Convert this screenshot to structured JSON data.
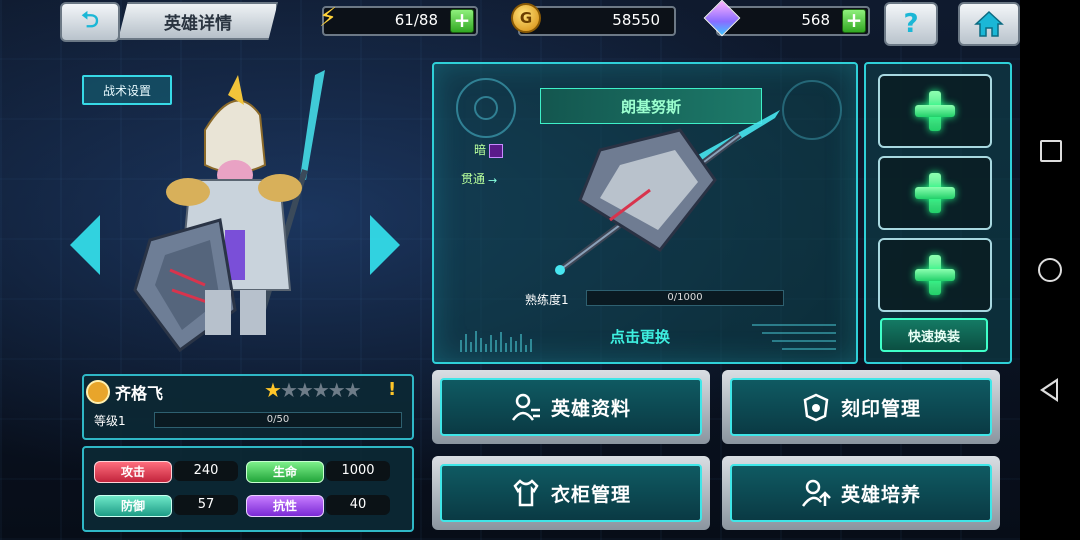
{
  "header": {
    "title": "英雄详情",
    "energy": {
      "value": "61/88",
      "icon": "lightning-icon"
    },
    "gold": {
      "value": "58550",
      "icon": "coin-icon",
      "coin_letter": "G"
    },
    "gems": {
      "value": "568",
      "icon": "gem-icon"
    },
    "help_label": "?"
  },
  "hero": {
    "tactic_button": "战术设置",
    "name": "齐格飞",
    "stars": {
      "filled": 1,
      "total": 6
    },
    "alert": "!",
    "level_label": "等级1",
    "level_progress": "0/50",
    "stats": [
      {
        "label": "攻击",
        "value": "240"
      },
      {
        "label": "生命",
        "value": "1000"
      },
      {
        "label": "防御",
        "value": "57"
      },
      {
        "label": "抗性",
        "value": "40"
      }
    ]
  },
  "weapon": {
    "name": "朗基努斯",
    "attributes": [
      "暗",
      "贯通"
    ],
    "proficiency_label": "熟练度1",
    "proficiency_progress": "0/1000",
    "swap_label": "点击更换"
  },
  "slots": {
    "count": 3,
    "quick_equip": "快速换装"
  },
  "menu": [
    {
      "label": "英雄资料",
      "icon": "profile-icon"
    },
    {
      "label": "刻印管理",
      "icon": "badge-icon"
    },
    {
      "label": "衣柜管理",
      "icon": "wardrobe-icon"
    },
    {
      "label": "英雄培养",
      "icon": "upgrade-icon"
    }
  ],
  "colors": {
    "accent": "#2fd0d8",
    "attack": "#c2243c",
    "health": "#22a43a",
    "defense": "#1d9c86",
    "resist": "#7a2ad4",
    "plus": "#32a823"
  }
}
